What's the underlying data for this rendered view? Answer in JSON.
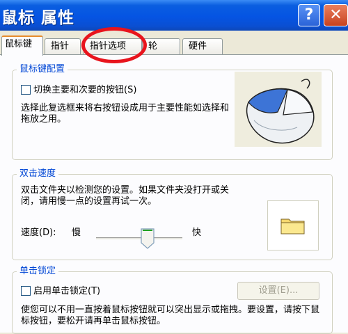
{
  "window": {
    "title": "鼠标 属性"
  },
  "tabs": [
    {
      "label": "鼠标键",
      "active": true
    },
    {
      "label": "指针"
    },
    {
      "label": "指针选项"
    },
    {
      "label": "轮"
    },
    {
      "label": "硬件"
    }
  ],
  "buttons_config": {
    "title": "鼠标键配置",
    "checkbox_label": "切换主要和次要的按钮(S)",
    "description": "选择此复选框来将右按钮设成用于主要性能如选择和拖放之用。"
  },
  "double_click": {
    "title": "双击速度",
    "description": "双击文件夹以检测您的设置。如果文件夹没打开或关闭，请用慢一点的设置再试一次。",
    "speed_label": "速度(D):",
    "slow_label": "慢",
    "fast_label": "快",
    "speed_level": 0.55
  },
  "click_lock": {
    "title": "单击锁定",
    "checkbox_label": "启用单击锁定(T)",
    "settings_button": "设置(E)...",
    "description": "使您可以不用一直按着鼠标按钮就可以突出显示或拖拽。要设置，请按下鼠标按钮，要松开请再单击鼠标按钮。"
  },
  "colors": {
    "accent": "#0046d5",
    "highlight_ring": "#e8141d"
  },
  "icons": [
    "help-icon",
    "close-icon",
    "mouse-icon",
    "folder-icon",
    "slider-thumb-icon"
  ]
}
